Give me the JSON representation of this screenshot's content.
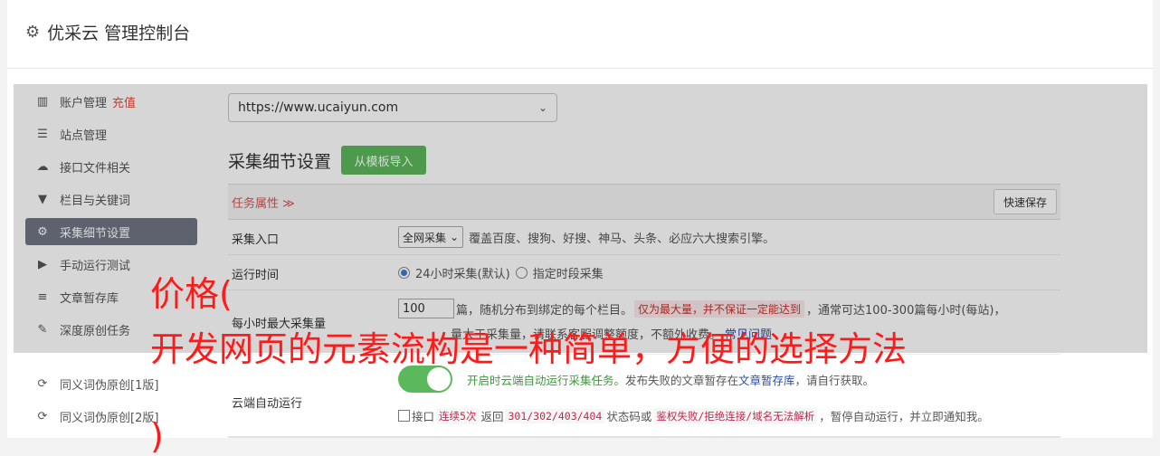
{
  "header": {
    "title": "优采云 管理控制台"
  },
  "sidebar": {
    "items": [
      {
        "label": "账户管理",
        "tag": "充值",
        "icon": "bar-chart-icon"
      },
      {
        "label": "站点管理",
        "icon": "server-icon"
      },
      {
        "label": "接口文件相关",
        "icon": "cloud-upload-icon"
      },
      {
        "label": "栏目与关键词",
        "icon": "filter-icon"
      },
      {
        "label": "采集细节设置",
        "icon": "gears-icon",
        "active": true
      },
      {
        "label": "手动运行测试",
        "icon": "play-circle-icon"
      },
      {
        "label": "文章暂存库",
        "icon": "database-icon"
      },
      {
        "label": "深度原创任务",
        "icon": "edit-icon"
      }
    ],
    "items2": [
      {
        "label": "同义词伪原创[1版]",
        "icon": "refresh-icon"
      },
      {
        "label": "同义词伪原创[2版]",
        "icon": "refresh-icon"
      }
    ]
  },
  "main": {
    "url_select": "https://www.ucaiyun.com",
    "section_title": "采集细节设置",
    "import_btn": "从模板导入",
    "task_props": "任务属性 ≫",
    "quick_save": "快速保存",
    "rows": {
      "entry": {
        "label": "采集入口",
        "select": "全网采集",
        "desc": "覆盖百度、搜狗、好搜、神马、头条、必应六大搜索引擎。"
      },
      "time": {
        "label": "运行时间",
        "opt1": "24小时采集(默认)",
        "opt2": "指定时段采集"
      },
      "max": {
        "label": "每小时最大采集量",
        "value": "100",
        "text1": "篇，随机分布到绑定的每个栏目。",
        "warn": "仅为最大量，并不保证一定能达到",
        "text2": "，通常可达100-300篇每小时(每站)，",
        "line2": "量大于采集量，请联系客服调整额度，不额外收费。",
        "line2_link": "常见问题"
      },
      "cloud": {
        "label": "云端自动运行",
        "text_green": "开启时云端自动运行采集任务。",
        "text_a": "发布失败的文章暂存在",
        "link": "文章暂存库",
        "text_b": "，请自行获取。",
        "chk_a": "接口",
        "code1": "连续5次",
        "chk_b": "返回",
        "code2": "301/302/403/404",
        "chk_c": "状态码或",
        "code3": "鉴权失败/拒绝连接/域名无法解析",
        "chk_d": "，暂停自动运行，并立即通知我。"
      }
    }
  },
  "overlay_text": {
    "line1": "价格(",
    "line2": "开发网页的元素流构是一种简单，方便的选择方法",
    "line3": ")"
  }
}
